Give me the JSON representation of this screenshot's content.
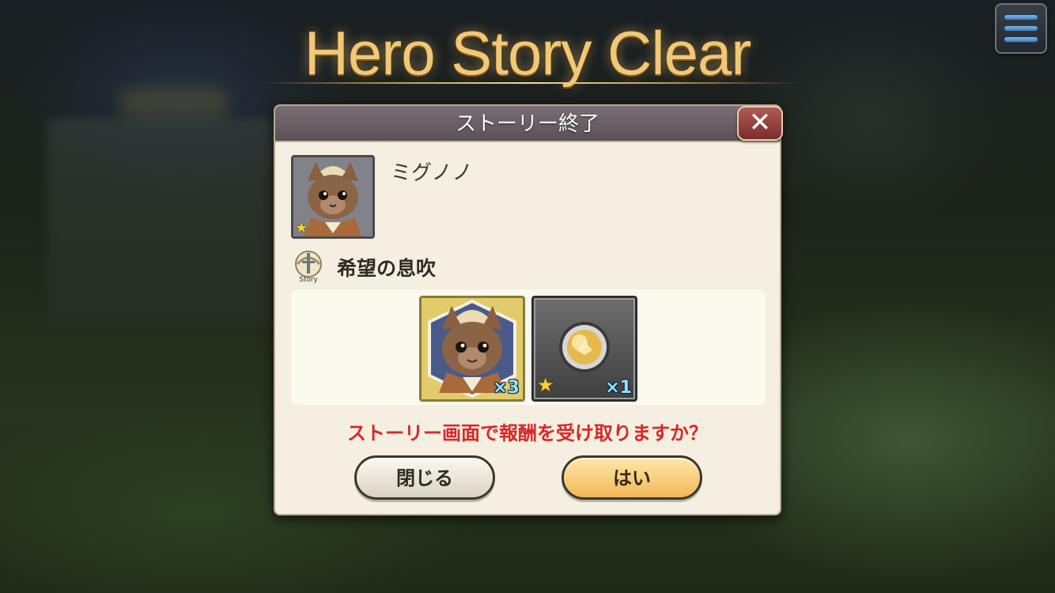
{
  "screen": {
    "title": "Hero Story Clear",
    "menu_icon": "hamburger-menu-icon"
  },
  "dialog": {
    "header_title": "ストーリー終了",
    "close_icon": "close-x-icon",
    "hero": {
      "name": "ミグノノ",
      "portrait_icon": "squirrel-hero-portrait",
      "rarity_star": "★"
    },
    "story": {
      "icon": "story-sword-icon",
      "icon_label": "Story",
      "title": "希望の息吹"
    },
    "rewards": [
      {
        "icon": "squirrel-hero-piece",
        "quantity": "×3",
        "star": ""
      },
      {
        "icon": "gold-orb-item",
        "quantity": "×1",
        "star": "★"
      }
    ],
    "question": "ストーリー画面で報酬を受け取りますか？",
    "buttons": {
      "close_label": "閉じる",
      "yes_label": "はい"
    }
  },
  "colors": {
    "title_gold": "#f0c878",
    "question_red": "#d72828",
    "header_bg": "#6a5f64",
    "yes_button": "#f1b958"
  }
}
